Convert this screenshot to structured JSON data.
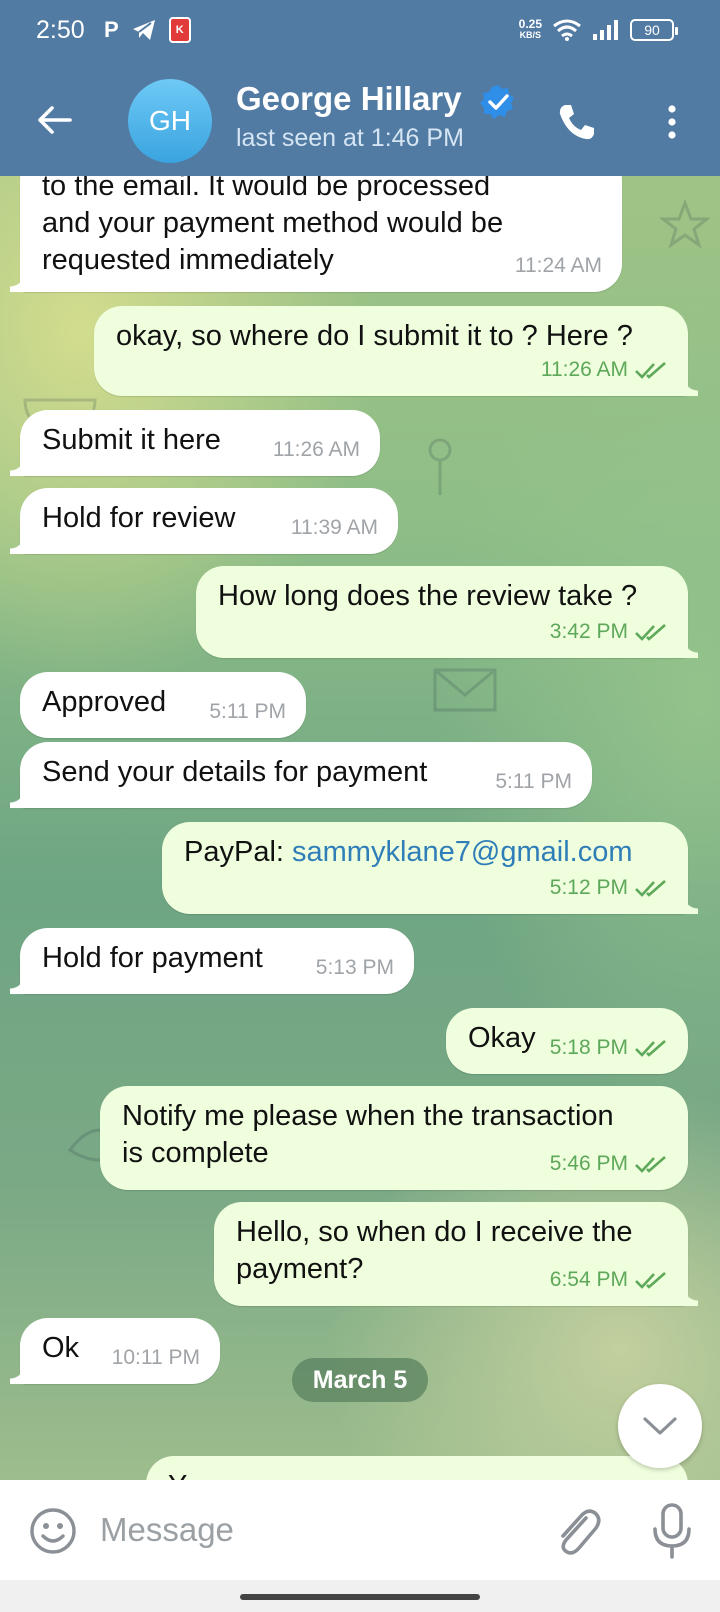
{
  "status_bar": {
    "time": "2:50",
    "net_speed_value": "0.25",
    "net_speed_unit": "KB/S",
    "battery": "90",
    "app_badge_letter": "K",
    "icons": [
      "parking-icon",
      "telegram-icon",
      "app-k-icon",
      "wifi-icon",
      "signal-icon",
      "battery-icon"
    ]
  },
  "header": {
    "avatar_initials": "GH",
    "contact_name": "George Hillary",
    "last_seen": "last seen at 1:46 PM",
    "icons": [
      "back-arrow-icon",
      "verified-badge-icon",
      "phone-icon",
      "more-vertical-icon"
    ],
    "colors": {
      "bar": "#517ba3",
      "avatar": "#3aa4e0",
      "verified": "#2f8fe8"
    }
  },
  "messages": [
    {
      "direction": "in",
      "lines": [
        "to the email. It would be processed",
        "and your payment method would be",
        "requested immediately"
      ],
      "time": "11:24 AM"
    },
    {
      "direction": "out",
      "text": "okay, so where do I submit it to ? Here ?",
      "time": "11:26 AM",
      "read": true
    },
    {
      "direction": "in",
      "text": "Submit it here",
      "time": "11:26 AM"
    },
    {
      "direction": "in",
      "text": "Hold for review",
      "time": "11:39 AM"
    },
    {
      "direction": "out",
      "text": "How long does the review take ?",
      "time": "3:42 PM",
      "read": true
    },
    {
      "direction": "in",
      "text": "Approved",
      "time": "5:11 PM"
    },
    {
      "direction": "in",
      "text": "Send your details for payment",
      "time": "5:11 PM"
    },
    {
      "direction": "out",
      "prefix": "PayPal: ",
      "link": "sammyklane7@gmail.com",
      "time": "5:12 PM",
      "read": true
    },
    {
      "direction": "in",
      "text": "Hold for payment",
      "time": "5:13 PM"
    },
    {
      "direction": "out",
      "text": "Okay",
      "time": "5:18 PM",
      "read": true
    },
    {
      "direction": "out",
      "lines": [
        "Notify me please when the transaction",
        "is complete"
      ],
      "time": "5:46 PM",
      "read": true
    },
    {
      "direction": "out",
      "lines": [
        "Hello, so when do I receive the",
        "payment?"
      ],
      "time": "6:54 PM",
      "read": true
    },
    {
      "direction": "in",
      "text": "Ok",
      "time": "10:11 PM"
    }
  ],
  "date_divider": "March 5",
  "partial_next_message": "Y",
  "composer": {
    "placeholder": "Message",
    "icons": [
      "emoji-icon",
      "attach-paperclip-icon",
      "microphone-icon",
      "chevron-down-icon"
    ]
  },
  "colors": {
    "incoming_bubble": "#ffffff",
    "outgoing_bubble": "#effedd",
    "outgoing_time": "#5ea85a",
    "link": "#2f7eb8"
  }
}
